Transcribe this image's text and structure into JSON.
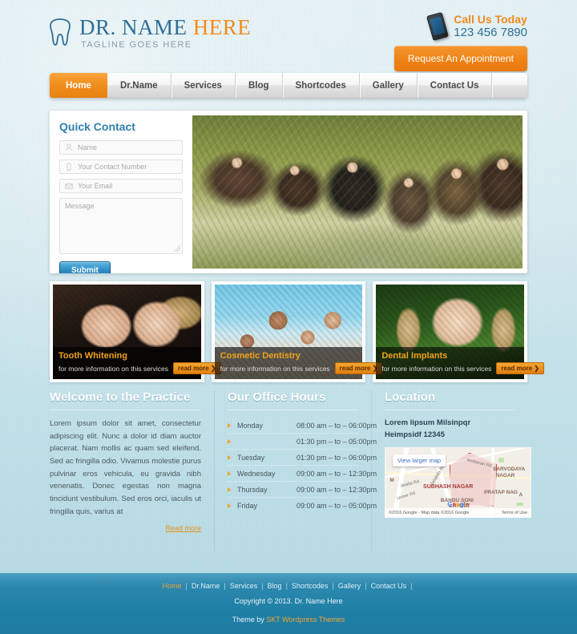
{
  "header": {
    "logo": {
      "icon": "tooth-icon",
      "main_prefix": "DR. NAME ",
      "main_accent": "HERE",
      "tagline": "TAGLINE GOES HERE"
    },
    "call": {
      "icon": "mobile-phone-icon",
      "label": "Call Us Today",
      "number": "123 456 7890"
    },
    "appointment_button": "Request An Appointment"
  },
  "nav": {
    "items": [
      {
        "label": "Home",
        "active": true
      },
      {
        "label": "Dr.Name",
        "active": false
      },
      {
        "label": "Services",
        "active": false
      },
      {
        "label": "Blog",
        "active": false
      },
      {
        "label": "Shortcodes",
        "active": false
      },
      {
        "label": "Gallery",
        "active": false
      },
      {
        "label": "Contact Us",
        "active": false
      }
    ]
  },
  "quick_contact": {
    "title": "Quick Contact",
    "fields": [
      {
        "icon": "user-icon",
        "placeholder": "Name",
        "value": ""
      },
      {
        "icon": "phone-icon",
        "placeholder": "Your Contact Number",
        "value": ""
      },
      {
        "icon": "envelope-icon",
        "placeholder": "Your Email",
        "value": ""
      }
    ],
    "message_placeholder": "Message",
    "message_value": "",
    "submit_label": "Submit"
  },
  "slider": {
    "alt": "Family of six smiling outdoors under a tree"
  },
  "services": [
    {
      "title": "Tooth Whitening",
      "subtitle": "for more information on this services",
      "read_more": "read more",
      "image_alt": "Smiling couple at an evening event"
    },
    {
      "title": "Cosmetic Dentistry",
      "subtitle": "for more information on this services",
      "read_more": "read more",
      "image_alt": "Family of four on a beach"
    },
    {
      "title": "Dental Implants",
      "subtitle": "for more information on this services",
      "read_more": "read more",
      "image_alt": "Smiling young girl with pigtails"
    }
  ],
  "welcome": {
    "title": "Welcome to the Practice",
    "body": "Lorem ipsum dolor sit amet, consectetur adipiscing elit. Nunc a dolor id diam auctor placerat. Nam mollis ac quam sed eleifend. Sed ac fringilla odio. Vivamus molestie purus pulvinar eros vehicula, eu gravida nibh venenatis. Donec egestas non magna tincidunt vestibulum. Sed eros orci, iaculis ut fringilla quis, varius at",
    "read_more": "Read more"
  },
  "office_hours": {
    "title": "Our Office Hours",
    "rows": [
      {
        "day": "Monday",
        "time": "08:00 am – to – 06:00pm"
      },
      {
        "day": "",
        "time": "01:30 pm – to – 05:00pm"
      },
      {
        "day": "Tuesday",
        "time": "01:30 pm – to – 06:00pm"
      },
      {
        "day": "Wednesday",
        "time": "09:00 am – to – 12:30pm"
      },
      {
        "day": "Thursday",
        "time": "09:00 am – to – 12:30pm"
      },
      {
        "day": "Friday",
        "time": "09:00 am – to – 05:00pm"
      }
    ]
  },
  "location": {
    "title": "Location",
    "address_line1": "Lorem lipsum Milsinpqr",
    "address_line2": "Heimpsidf 12345",
    "map": {
      "view_larger": "View larger map",
      "labels": [
        {
          "text": "SUBHASH NAGAR",
          "kind": "red"
        },
        {
          "text": "SARVODAYA",
          "kind": "area"
        },
        {
          "text": "NAGAR",
          "kind": "area"
        },
        {
          "text": "PRATAP NAG",
          "kind": "area"
        },
        {
          "text": "BANDU SONI",
          "kind": "area"
        },
        {
          "text": "LAYOUT",
          "kind": "area"
        },
        {
          "text": "M",
          "kind": "area"
        },
        {
          "text": "A",
          "kind": "area"
        }
      ],
      "roads": [
        "Jatalia Rd",
        "Jasalala Rd",
        "Urmer Rd",
        "Ambazari Rd"
      ],
      "attribution_left": "©2016 Google - Map data ©2016 Google",
      "attribution_right": "Terms of Use",
      "brand_letters": [
        "G",
        "o",
        "o",
        "g",
        "l",
        "e"
      ]
    }
  },
  "footer": {
    "nav": [
      {
        "label": "Home",
        "active": true
      },
      {
        "label": "Dr.Name",
        "active": false
      },
      {
        "label": "Services",
        "active": false
      },
      {
        "label": "Blog",
        "active": false
      },
      {
        "label": "Shortcodes",
        "active": false
      },
      {
        "label": "Gallery",
        "active": false
      },
      {
        "label": "Contact Us",
        "active": false
      }
    ],
    "separator": "|",
    "copyright": "Copyright © 2013. Dr. Name Here",
    "theme_prefix": "Theme by ",
    "theme_link": "SKT Wordpress Themes"
  },
  "colors": {
    "accent_orange": "#f08b1d",
    "brand_blue": "#2f6e95",
    "footer_blue": "#2080a6",
    "page_bg": "#cfe4ea"
  }
}
